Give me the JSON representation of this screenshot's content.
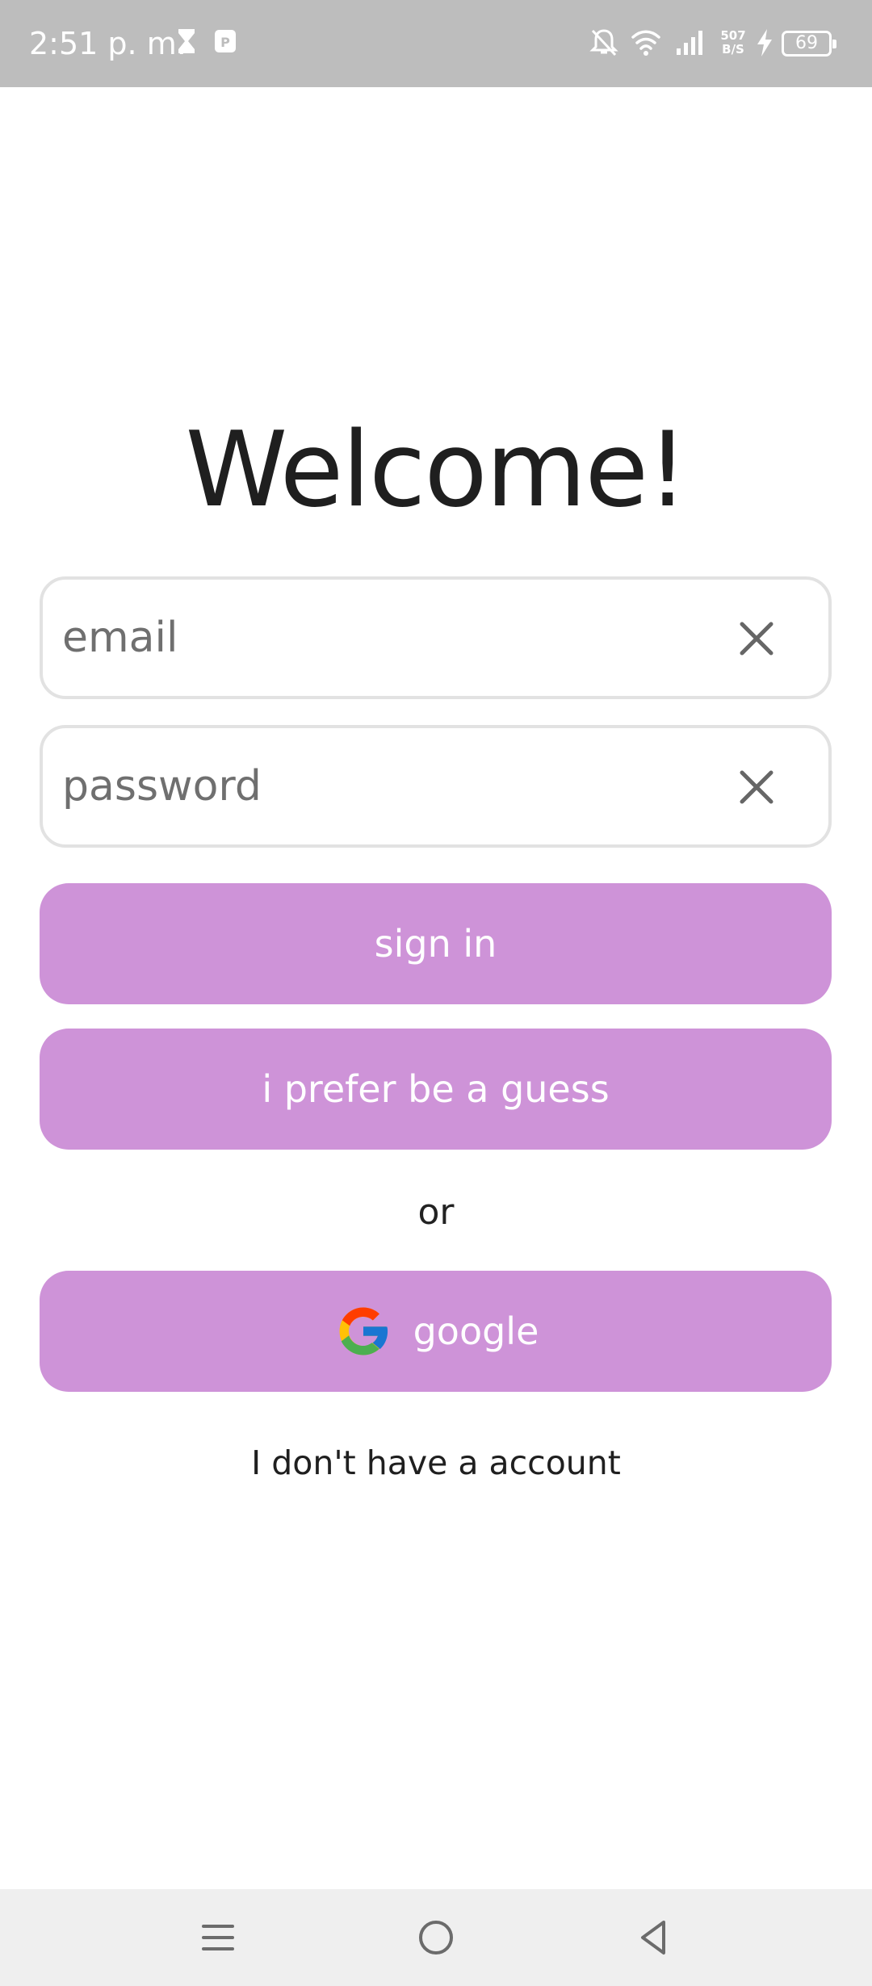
{
  "status_bar": {
    "time": "2:51 p. m.",
    "net_speed_value": "507",
    "net_speed_unit": "B/S",
    "battery": "69",
    "icons": [
      "hourglass-icon",
      "pdf-app-icon",
      "mute-icon",
      "wifi-icon",
      "signal-icon",
      "charging-icon",
      "battery-icon"
    ]
  },
  "title": "Welcome!",
  "form": {
    "email_placeholder": "email",
    "password_placeholder": "password"
  },
  "buttons": {
    "sign_in": "sign in",
    "guest": "i prefer be a guess",
    "google": "google"
  },
  "or_text": "or",
  "signup_link": "I don't have a account",
  "colors": {
    "button_bg": "#ce93d8",
    "button_text": "#ffffff",
    "status_bar_bg": "#bdbdbd",
    "nav_bar_bg": "#efefef"
  },
  "nav_bar": {
    "icons": [
      "menu-icon",
      "home-icon",
      "back-icon"
    ]
  }
}
